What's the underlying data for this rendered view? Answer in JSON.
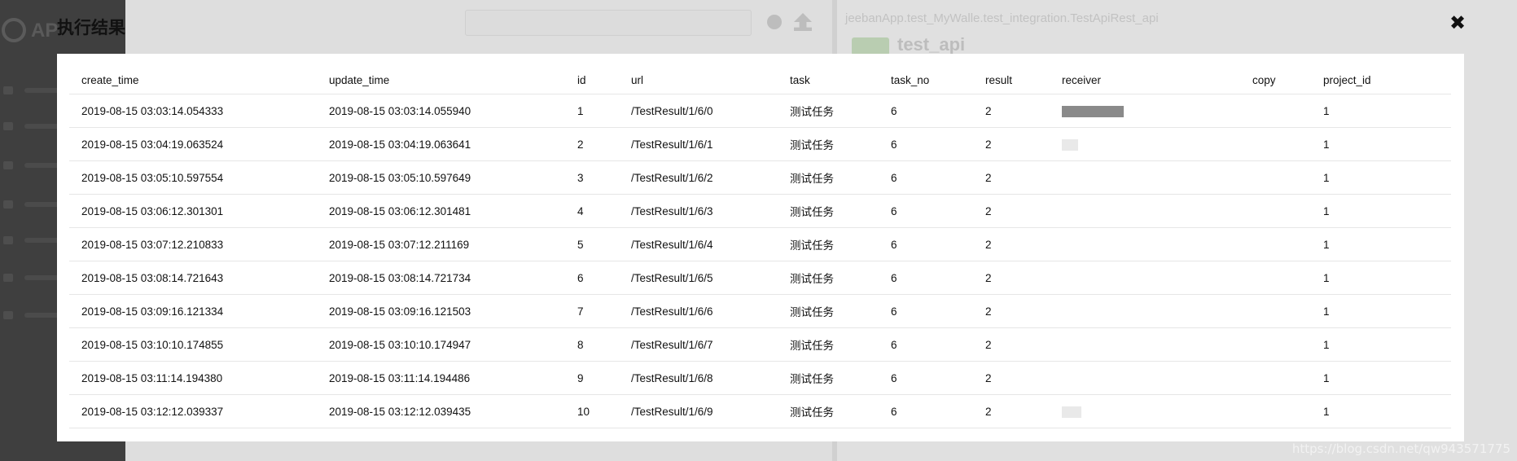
{
  "modal": {
    "title": "执行结果",
    "close_symbol": "✖"
  },
  "background": {
    "logo_text": "AP",
    "path_text": "jeebanApp.test_MyWalle.test_integration.TestApiRest_api",
    "api_name": "test_api"
  },
  "table": {
    "columns": [
      "create_time",
      "update_time",
      "id",
      "url",
      "task",
      "task_no",
      "result",
      "receiver",
      "copy",
      "project_id"
    ],
    "rows": [
      {
        "create_time": "2019-08-15 03:03:14.054333",
        "update_time": "2019-08-15 03:03:14.055940",
        "id": "1",
        "url": "/TestResult/1/6/0",
        "task": "测试任务",
        "task_no": "6",
        "result": "2",
        "receiver": "",
        "copy": "",
        "project_id": "1"
      },
      {
        "create_time": "2019-08-15 03:04:19.063524",
        "update_time": "2019-08-15 03:04:19.063641",
        "id": "2",
        "url": "/TestResult/1/6/1",
        "task": "测试任务",
        "task_no": "6",
        "result": "2",
        "receiver": "",
        "copy": "",
        "project_id": "1"
      },
      {
        "create_time": "2019-08-15 03:05:10.597554",
        "update_time": "2019-08-15 03:05:10.597649",
        "id": "3",
        "url": "/TestResult/1/6/2",
        "task": "测试任务",
        "task_no": "6",
        "result": "2",
        "receiver": "",
        "copy": "",
        "project_id": "1"
      },
      {
        "create_time": "2019-08-15 03:06:12.301301",
        "update_time": "2019-08-15 03:06:12.301481",
        "id": "4",
        "url": "/TestResult/1/6/3",
        "task": "测试任务",
        "task_no": "6",
        "result": "2",
        "receiver": "",
        "copy": "",
        "project_id": "1"
      },
      {
        "create_time": "2019-08-15 03:07:12.210833",
        "update_time": "2019-08-15 03:07:12.211169",
        "id": "5",
        "url": "/TestResult/1/6/4",
        "task": "测试任务",
        "task_no": "6",
        "result": "2",
        "receiver": "",
        "copy": "",
        "project_id": "1"
      },
      {
        "create_time": "2019-08-15 03:08:14.721643",
        "update_time": "2019-08-15 03:08:14.721734",
        "id": "6",
        "url": "/TestResult/1/6/5",
        "task": "测试任务",
        "task_no": "6",
        "result": "2",
        "receiver": "",
        "copy": "",
        "project_id": "1"
      },
      {
        "create_time": "2019-08-15 03:09:16.121334",
        "update_time": "2019-08-15 03:09:16.121503",
        "id": "7",
        "url": "/TestResult/1/6/6",
        "task": "测试任务",
        "task_no": "6",
        "result": "2",
        "receiver": "",
        "copy": "",
        "project_id": "1"
      },
      {
        "create_time": "2019-08-15 03:10:10.174855",
        "update_time": "2019-08-15 03:10:10.174947",
        "id": "8",
        "url": "/TestResult/1/6/7",
        "task": "测试任务",
        "task_no": "6",
        "result": "2",
        "receiver": "",
        "copy": "",
        "project_id": "1"
      },
      {
        "create_time": "2019-08-15 03:11:14.194380",
        "update_time": "2019-08-15 03:11:14.194486",
        "id": "9",
        "url": "/TestResult/1/6/8",
        "task": "测试任务",
        "task_no": "6",
        "result": "2",
        "receiver": "",
        "copy": "",
        "project_id": "1"
      },
      {
        "create_time": "2019-08-15 03:12:12.039337",
        "update_time": "2019-08-15 03:12:12.039435",
        "id": "10",
        "url": "/TestResult/1/6/9",
        "task": "测试任务",
        "task_no": "6",
        "result": "2",
        "receiver": "",
        "copy": "",
        "project_id": "1"
      }
    ]
  },
  "watermark": "https://blog.csdn.net/qw943571775"
}
